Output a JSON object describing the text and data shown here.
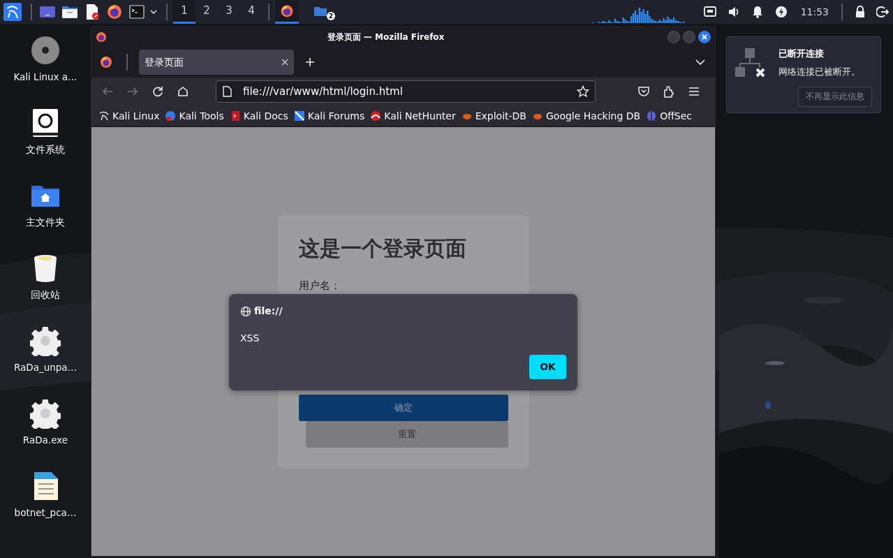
{
  "taskbar": {
    "launchers": [
      {
        "kind": "kali-menu"
      },
      {
        "kind": "desktop"
      },
      {
        "kind": "files"
      },
      {
        "kind": "editor"
      },
      {
        "kind": "firefox"
      },
      {
        "kind": "terminal"
      }
    ],
    "workspaces": [
      {
        "label": "1",
        "selected": true
      },
      {
        "label": "2",
        "selected": false
      },
      {
        "label": "3",
        "selected": false
      },
      {
        "label": "4",
        "selected": false
      }
    ],
    "tasks": [
      {
        "kind": "firefox",
        "selected": true
      },
      {
        "kind": "folder",
        "badge": "2",
        "selected": false
      }
    ],
    "clock": "11:53"
  },
  "desktop_icons": [
    {
      "label": "Kali Linux a…",
      "kind": "disc"
    },
    {
      "label": "文件系统",
      "kind": "drive"
    },
    {
      "label": "主文件夹",
      "kind": "home"
    },
    {
      "label": "回收站",
      "kind": "trash"
    },
    {
      "label": "RaDa_unpa…",
      "kind": "gear"
    },
    {
      "label": "RaDa.exe",
      "kind": "gear"
    },
    {
      "label": "botnet_pca…",
      "kind": "binary"
    }
  ],
  "browser": {
    "title": "登录页面 — Mozilla Firefox",
    "tabs": [
      {
        "label": "登录页面",
        "selected": true
      }
    ],
    "url": "file:///var/www/html/login.html",
    "bookmarks": [
      {
        "label": "Kali Linux",
        "kind": "dragon"
      },
      {
        "label": "Kali Tools",
        "kind": "tools"
      },
      {
        "label": "Kali Docs",
        "kind": "docs"
      },
      {
        "label": "Kali Forums",
        "kind": "forums"
      },
      {
        "label": "Kali NetHunter",
        "kind": "nethunter"
      },
      {
        "label": "Exploit-DB",
        "kind": "bug"
      },
      {
        "label": "Google Hacking DB",
        "kind": "bug"
      },
      {
        "label": "OffSec",
        "kind": "offsec"
      }
    ],
    "page": {
      "heading": "这是一个登录页面",
      "username_label": "用户名：",
      "submit": "确定",
      "reset": "重置"
    },
    "dialog": {
      "origin": "file://",
      "message": "XSS",
      "ok": "OK"
    }
  },
  "notification": {
    "title": "已断开连接",
    "message": "网络连接已被断开。",
    "button": "不再显示此信息"
  }
}
